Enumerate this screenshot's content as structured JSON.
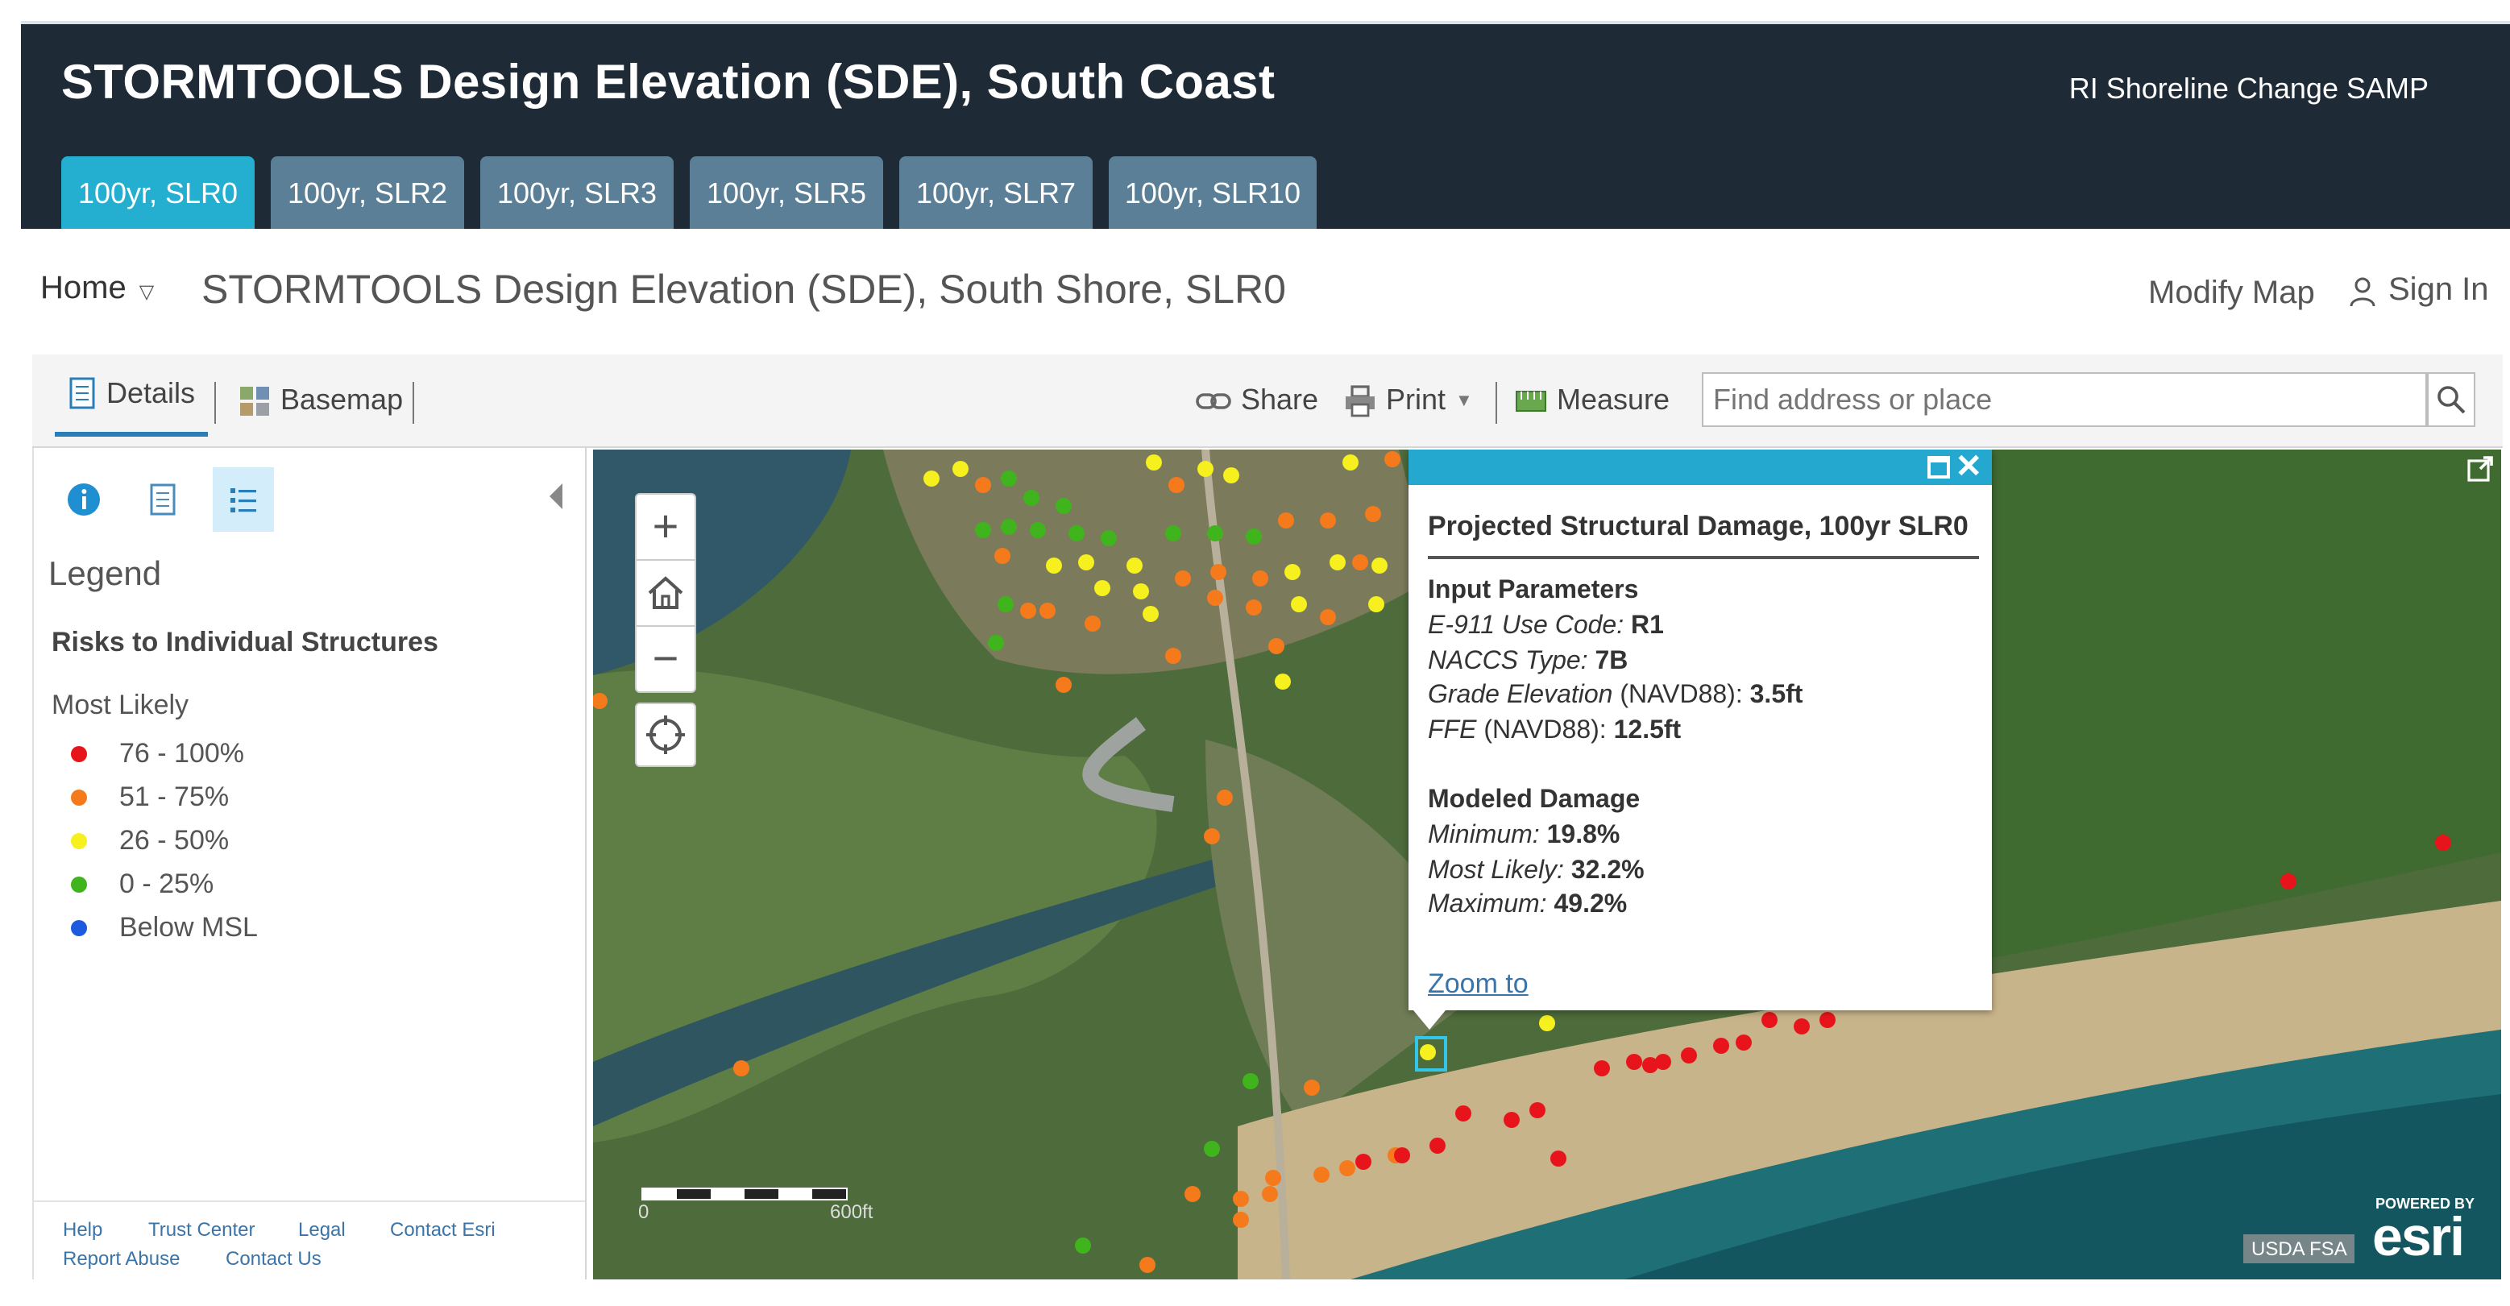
{
  "banner": {
    "title": "STORMTOOLS Design Elevation (SDE), South Coast",
    "subtitle": "RI Shoreline Change SAMP",
    "tabs": [
      "100yr, SLR0",
      "100yr, SLR2",
      "100yr, SLR3",
      "100yr, SLR5",
      "100yr, SLR7",
      "100yr, SLR10"
    ],
    "active_tab": "100yr, SLR0"
  },
  "titlebar": {
    "home": "Home",
    "map_title": "STORMTOOLS Design Elevation (SDE), South Shore, SLR0",
    "modify": "Modify Map",
    "signin": "Sign In"
  },
  "toolbar": {
    "details": "Details",
    "basemap": "Basemap",
    "share": "Share",
    "print": "Print",
    "measure": "Measure",
    "search_placeholder": "Find address or place"
  },
  "legend": {
    "heading": "Legend",
    "layer": "Risks to Individual Structures",
    "field": "Most Likely",
    "items": [
      {
        "label": "76 - 100%",
        "color": "#e8141c"
      },
      {
        "label": "51 - 75%",
        "color": "#f57a1c"
      },
      {
        "label": "26 - 50%",
        "color": "#f5f01e"
      },
      {
        "label": "0 - 25%",
        "color": "#3fb41c"
      },
      {
        "label": "Below MSL",
        "color": "#1c5ae0"
      }
    ]
  },
  "footer": {
    "help": "Help",
    "trust": "Trust Center",
    "legal": "Legal",
    "contact_esri": "Contact Esri",
    "report": "Report Abuse",
    "contact_us": "Contact Us"
  },
  "map": {
    "scale_start": "0",
    "scale_end": "600ft",
    "attribution": "USDA FSA",
    "powered_by": "POWERED BY",
    "esri": "esri"
  },
  "popup": {
    "title": "Projected Structural Damage, 100yr SLR0",
    "input_heading": "Input Parameters",
    "e911_label": "E-911 Use Code:",
    "e911_value": "R1",
    "naccs_label": "NACCS Type:",
    "naccs_value": "7B",
    "grade_label": "Grade Elevation",
    "grade_unit": "(NAVD88):",
    "grade_value": "3.5ft",
    "ffe_label": "FFE",
    "ffe_unit": "(NAVD88):",
    "ffe_value": "12.5ft",
    "damage_heading": "Modeled Damage",
    "min_label": "Minimum:",
    "min_value": "19.8%",
    "likely_label": "Most Likely:",
    "likely_value": "32.2%",
    "max_label": "Maximum:",
    "max_value": "49.2%",
    "zoom": "Zoom to"
  }
}
